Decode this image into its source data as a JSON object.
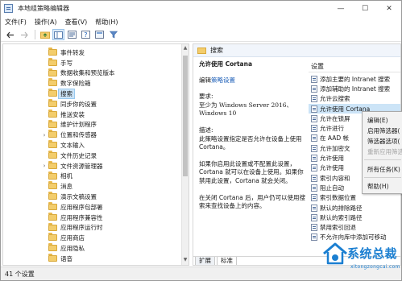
{
  "window": {
    "title": "本地组策略编辑器",
    "controls": [
      "—",
      "☐",
      "✕"
    ]
  },
  "menubar": [
    "文件(F)",
    "操作(A)",
    "查看(V)",
    "帮助(H)"
  ],
  "toolbar": {
    "buttons": [
      {
        "name": "back-icon",
        "glyph": "←"
      },
      {
        "name": "forward-icon",
        "glyph": "→"
      },
      {
        "name": "up-folder-icon",
        "glyph": "▲"
      },
      {
        "name": "show-tree-icon",
        "glyph": "▦"
      },
      {
        "name": "properties-icon",
        "glyph": "▤"
      },
      {
        "name": "help-icon",
        "glyph": "?"
      },
      {
        "name": "view-icon",
        "glyph": "▣"
      },
      {
        "name": "filter-icon",
        "glyph": "▼"
      }
    ]
  },
  "tree": {
    "items": [
      {
        "label": "事件转发",
        "expandable": false
      },
      {
        "label": "手写",
        "expandable": false
      },
      {
        "label": "数据收集和预览版本",
        "expandable": false
      },
      {
        "label": "数字保险箱",
        "expandable": false
      },
      {
        "label": "搜索",
        "expandable": false,
        "selected": true
      },
      {
        "label": "同步你的设置",
        "expandable": false
      },
      {
        "label": "推送安装",
        "expandable": false
      },
      {
        "label": "维护计划程序",
        "expandable": false
      },
      {
        "label": "位置和传感器",
        "expandable": true
      },
      {
        "label": "文本输入",
        "expandable": false
      },
      {
        "label": "文件历史记录",
        "expandable": false
      },
      {
        "label": "文件资源管理器",
        "expandable": true
      },
      {
        "label": "相机",
        "expandable": false
      },
      {
        "label": "消息",
        "expandable": false
      },
      {
        "label": "演示文稿设置",
        "expandable": false
      },
      {
        "label": "应用程序包部署",
        "expandable": false
      },
      {
        "label": "应用程序兼容性",
        "expandable": false
      },
      {
        "label": "应用程序运行时",
        "expandable": false
      },
      {
        "label": "应用商店",
        "expandable": false
      },
      {
        "label": "应用隐私",
        "expandable": false
      },
      {
        "label": "语音",
        "expandable": false
      }
    ]
  },
  "right_pane": {
    "header": "搜索",
    "policy_title": "允许使用 Cortana",
    "edit_prefix": "编辑",
    "edit_link": "策略设置",
    "requirements_label": "要求:",
    "requirements_text": "至少为 Windows Server 2016、Windows 10",
    "description_label": "描述:",
    "description_text": "此策略设置指定是否允许在设备上使用 Cortana。",
    "enabled_text": "如果你启用此设置或不配置此设置，Cortana 就可以在设备上使用。如果你禁用此设置，Cortana 就会关闭。",
    "disabled_text": "在关闭 Cortana 后，用户仍可以使用搜索来查找设备上的内容。"
  },
  "settings": {
    "column_header": "设置",
    "items": [
      {
        "label": "添加主要的 Intranet 搜索"
      },
      {
        "label": "添加辅助的 Intranet 搜索"
      },
      {
        "label": "允许云搜索"
      },
      {
        "label": "允许使用 Cortana",
        "selected": true
      },
      {
        "label": "允许在锁屏"
      },
      {
        "label": "允许进行"
      },
      {
        "label": "在 AAD 帐"
      },
      {
        "label": "允许加密文"
      },
      {
        "label": "允许使用"
      },
      {
        "label": "允许使用"
      },
      {
        "label": "索引内容和"
      },
      {
        "label": "阻止自动"
      },
      {
        "label": "索引数据位置"
      },
      {
        "label": "默认的排除路径"
      },
      {
        "label": "默认的索引路径"
      },
      {
        "label": "禁用索引回退"
      },
      {
        "label": "不允许向库中添加可移动"
      }
    ]
  },
  "tabs": [
    {
      "label": "扩展",
      "active": false
    },
    {
      "label": "标准",
      "active": true
    }
  ],
  "context_menu": {
    "items": [
      {
        "label": "编辑(E)",
        "disabled": false
      },
      {
        "label": "启用筛选器(",
        "disabled": false
      },
      {
        "label": "筛选器选项(",
        "disabled": false
      },
      {
        "label": "重新应用筛选",
        "disabled": true
      },
      {
        "label": "所有任务(K)",
        "disabled": false
      },
      {
        "label": "帮助(H)",
        "disabled": false
      }
    ]
  },
  "statusbar": {
    "text": "41 个设置"
  },
  "watermark": {
    "brand": "系统总裁",
    "url": "xitongzongcai.com",
    "color": "#1b7fd1"
  }
}
